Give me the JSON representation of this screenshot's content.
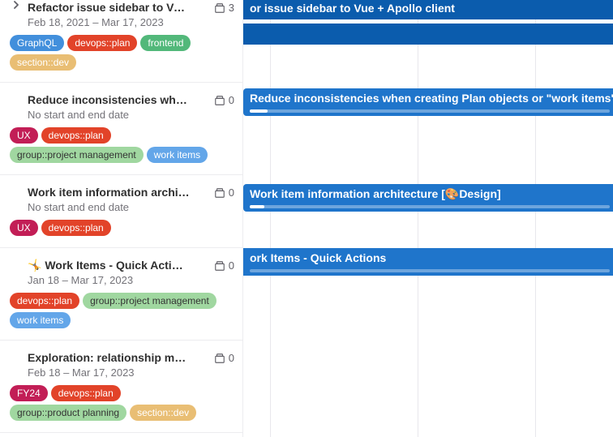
{
  "epics": [
    {
      "title": "Refactor issue sidebar to Vue + …",
      "dates": "Feb 18, 2021 – Mar 17, 2023",
      "child_count": "3",
      "has_chevron": true,
      "labels": [
        {
          "text": "GraphQL",
          "bg": "#428fdc"
        },
        {
          "text": "devops::plan",
          "bg": "#e24329"
        },
        {
          "text": "frontend",
          "bg": "#52b87a"
        },
        {
          "text": "section::dev",
          "bg": "#e9be74"
        }
      ]
    },
    {
      "title": "Reduce inconsistencies when cre…",
      "dates": "No start and end date",
      "child_count": "0",
      "has_chevron": false,
      "labels": [
        {
          "text": "UX",
          "bg": "#c21e56"
        },
        {
          "text": "devops::plan",
          "bg": "#e24329"
        },
        {
          "text": "group::project management",
          "bg": "#a0d7a0",
          "outline": true
        },
        {
          "text": "work items",
          "bg": "#63a6e9"
        }
      ]
    },
    {
      "title": "Work item information architectur…",
      "dates": "No start and end date",
      "child_count": "0",
      "has_chevron": false,
      "labels": [
        {
          "text": "UX",
          "bg": "#c21e56"
        },
        {
          "text": "devops::plan",
          "bg": "#e24329"
        }
      ]
    },
    {
      "title": "🤸 Work Items - Quick Actions",
      "dates": "Jan 18 – Mar 17, 2023",
      "child_count": "0",
      "has_chevron": false,
      "labels": [
        {
          "text": "devops::plan",
          "bg": "#e24329"
        },
        {
          "text": "group::project management",
          "bg": "#a0d7a0",
          "outline": true
        },
        {
          "text": "work items",
          "bg": "#63a6e9"
        }
      ]
    },
    {
      "title": "Exploration: relationship managem…",
      "dates": "Feb 18 – Mar 17, 2023",
      "child_count": "0",
      "has_chevron": false,
      "labels": [
        {
          "text": "FY24",
          "bg": "#c21e56"
        },
        {
          "text": "devops::plan",
          "bg": "#e24329"
        },
        {
          "text": "group::product planning",
          "bg": "#a0d7a0",
          "outline": true
        },
        {
          "text": "section::dev",
          "bg": "#e9be74"
        }
      ]
    }
  ],
  "bars": {
    "b1_text": "or issue sidebar to Vue + Apollo client",
    "b3_text": "Reduce inconsistencies when creating Plan objects or \"work items\"",
    "b4_text": "Work item information architecture [🎨Design]",
    "b5_text": "ork Items - Quick Actions"
  }
}
